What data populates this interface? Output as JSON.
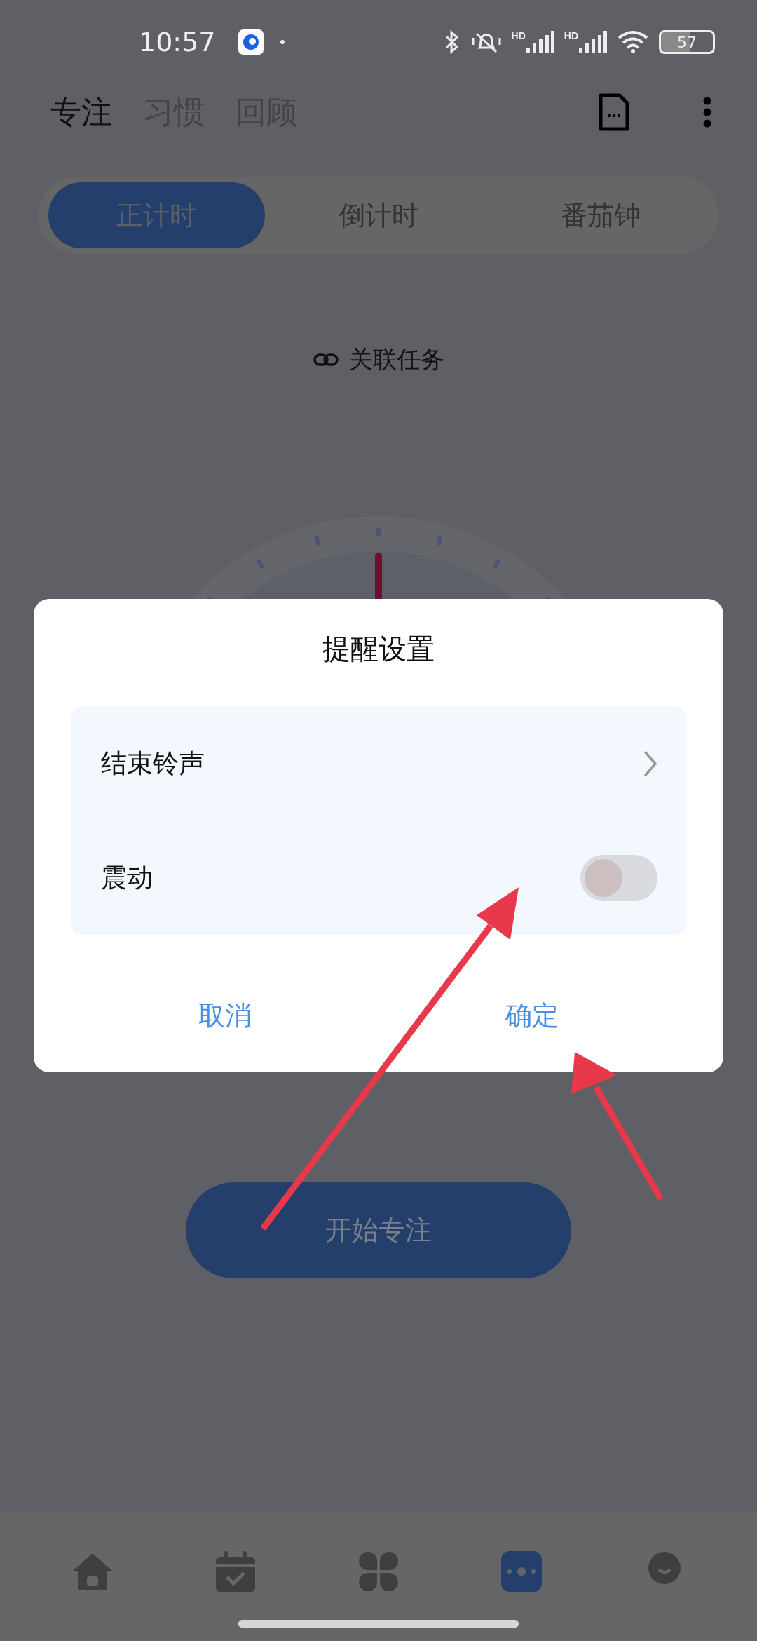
{
  "status_bar": {
    "time": "10:57",
    "battery": "57",
    "signal_labels": [
      "HD",
      "HD"
    ]
  },
  "top_tabs": [
    {
      "label": "专注",
      "selected": true
    },
    {
      "label": "习惯",
      "selected": false
    },
    {
      "label": "回顾",
      "selected": false
    }
  ],
  "mode_tabs": [
    {
      "label": "正计时",
      "selected": true
    },
    {
      "label": "倒计时",
      "selected": false
    },
    {
      "label": "番茄钟",
      "selected": false
    }
  ],
  "linked_task": "关联任务",
  "start_button": "开始专注",
  "bottom_nav": [
    {
      "kind": "home",
      "selected": false
    },
    {
      "kind": "calendar",
      "selected": false
    },
    {
      "kind": "apps",
      "selected": false
    },
    {
      "kind": "focus",
      "selected": true
    },
    {
      "kind": "profile",
      "selected": false
    }
  ],
  "dialog": {
    "title": "提醒设置",
    "rows": [
      {
        "kind": "link",
        "label": "结束铃声"
      },
      {
        "kind": "toggle",
        "label": "震动",
        "on": false
      }
    ],
    "cancel": "取消",
    "confirm": "确定"
  }
}
